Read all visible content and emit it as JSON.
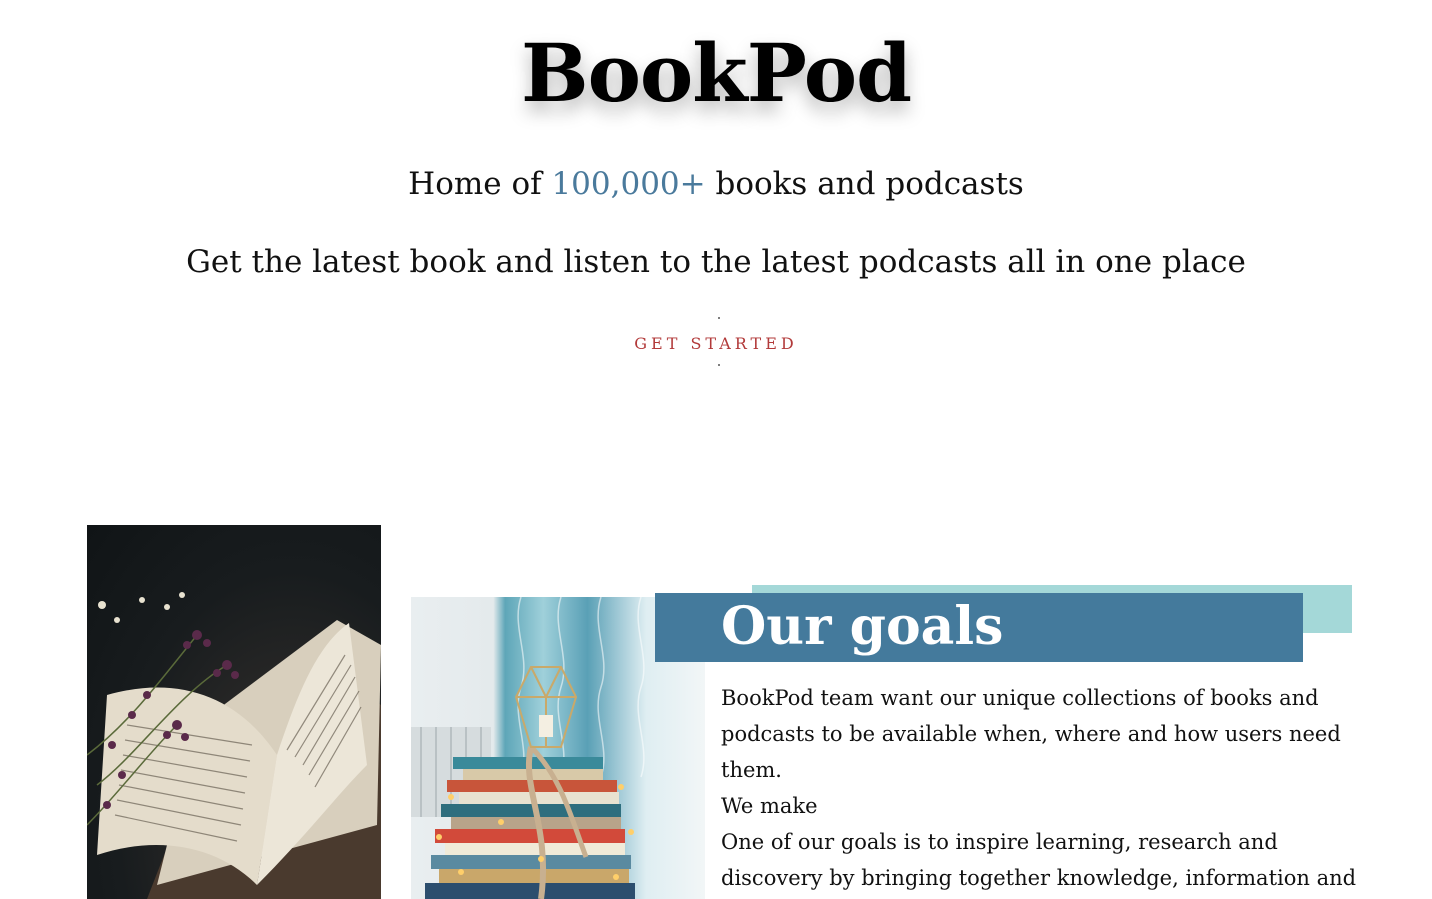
{
  "hero": {
    "title": "BookPod",
    "subtitle_prefix": "Home of ",
    "subtitle_accent": "100,000+",
    "subtitle_suffix": " books and podcasts",
    "tagline": "Get the latest book and listen to the latest podcasts all in one place",
    "cta_label": "GET STARTED"
  },
  "goals": {
    "title": "Our goals",
    "paragraphs": [
      "BookPod team want our unique collections of books and podcasts to be available when, where and how users need them.",
      "We make",
      "One of our goals is to inspire learning, research and discovery by bringing together knowledge, information and people. And"
    ]
  },
  "colors": {
    "accent_blue": "#447a9c",
    "teal": "#a4d8d8",
    "cta_red": "#b23a3a"
  }
}
